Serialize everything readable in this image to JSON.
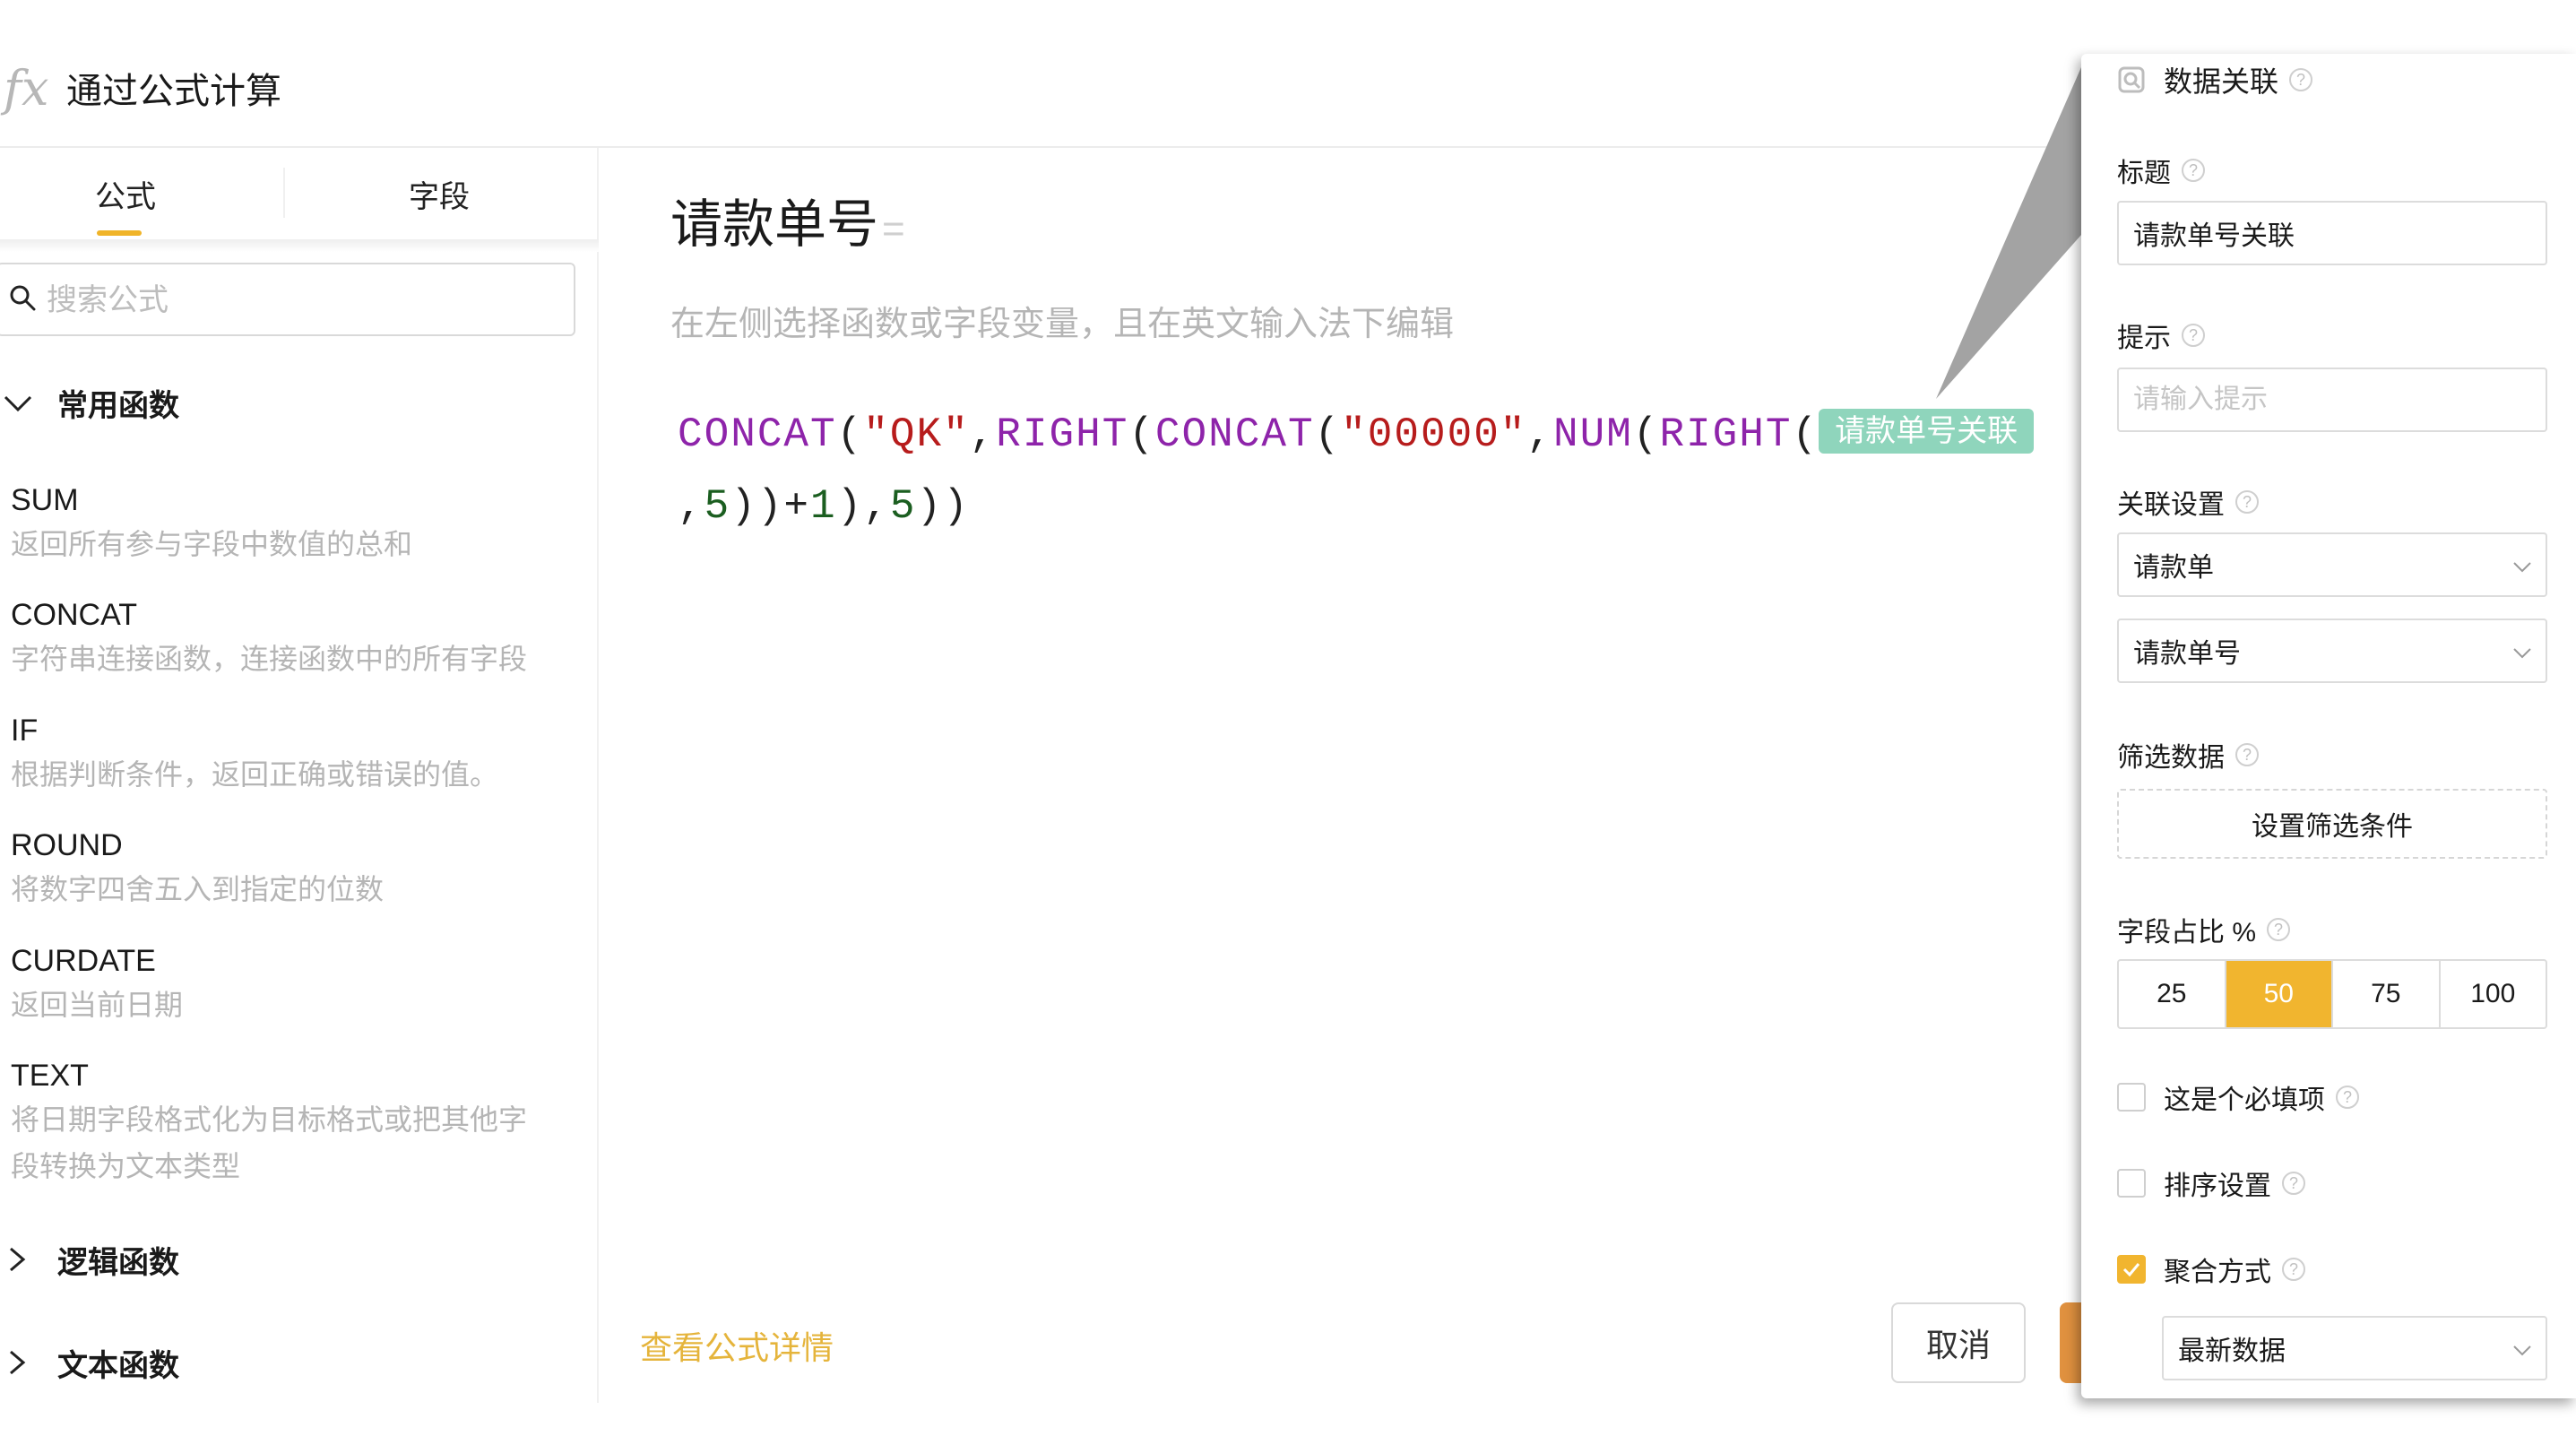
{
  "header": {
    "fx_icon": "fx",
    "title": "通过公式计算"
  },
  "left_panel": {
    "tabs": [
      {
        "label": "公式"
      },
      {
        "label": "字段"
      }
    ],
    "search": {
      "placeholder": "搜索公式",
      "value": ""
    },
    "categories": [
      {
        "label": "常用函数",
        "expanded": true,
        "functions": [
          {
            "name": "SUM",
            "desc": "返回所有参与字段中数值的总和"
          },
          {
            "name": "CONCAT",
            "desc": "字符串连接函数，连接函数中的所有字段"
          },
          {
            "name": "IF",
            "desc": "根据判断条件，返回正确或错误的值。"
          },
          {
            "name": "ROUND",
            "desc": "将数字四舍五入到指定的位数"
          },
          {
            "name": "CURDATE",
            "desc": "返回当前日期"
          },
          {
            "name": "TEXT",
            "desc": "将日期字段格式化为目标格式或把其他字",
            "desc2": "段转换为文本类型"
          }
        ]
      },
      {
        "label": "逻辑函数",
        "expanded": false
      },
      {
        "label": "文本函数",
        "expanded": false
      }
    ]
  },
  "editor": {
    "field_title": "请款单号",
    "equals": "=",
    "hint": "在左侧选择函数或字段变量，且在英文输入法下编辑",
    "formula": {
      "line1": [
        {
          "t": "k",
          "v": "CONCAT"
        },
        {
          "t": "p",
          "v": "("
        },
        {
          "t": "s",
          "v": "\"QK\""
        },
        {
          "t": "p",
          "v": ","
        },
        {
          "t": "k",
          "v": "RIGHT"
        },
        {
          "t": "p",
          "v": "("
        },
        {
          "t": "k",
          "v": "CONCAT"
        },
        {
          "t": "p",
          "v": "("
        },
        {
          "t": "s",
          "v": "\"00000\""
        },
        {
          "t": "p",
          "v": ","
        },
        {
          "t": "k",
          "v": "NUM"
        },
        {
          "t": "p",
          "v": "("
        },
        {
          "t": "k",
          "v": "RIGHT"
        },
        {
          "t": "p",
          "v": "("
        }
      ],
      "field_chip": "请款单号关联",
      "line2": [
        {
          "t": "p",
          "v": ","
        },
        {
          "t": "n",
          "v": "5"
        },
        {
          "t": "p",
          "v": "))+"
        },
        {
          "t": "n",
          "v": "1"
        },
        {
          "t": "p",
          "v": "),"
        },
        {
          "t": "n",
          "v": "5"
        },
        {
          "t": "p",
          "v": "))"
        }
      ]
    },
    "details_link": "查看公式详情",
    "cancel_label": "取消"
  },
  "side_panel": {
    "header_title": "数据关联",
    "title_label": "标题",
    "title_value": "请款单号关联",
    "hint_label": "提示",
    "hint_placeholder": "请输入提示",
    "link_label": "关联设置",
    "link_form": "请款单",
    "link_field": "请款单号",
    "filter_label": "筛选数据",
    "filter_button": "设置筛选条件",
    "ratio_label": "字段占比 %",
    "ratio_options": [
      "25",
      "50",
      "75",
      "100"
    ],
    "ratio_selected": "50",
    "required_label": "这是个必填项",
    "required_checked": false,
    "sort_label": "排序设置",
    "sort_checked": false,
    "aggregate_label": "聚合方式",
    "aggregate_checked": true,
    "aggregate_value": "最新数据"
  },
  "colors": {
    "accent": "#f1b52f",
    "chip": "#8fd5bc",
    "function_keyword": "#8e24aa",
    "string_literal": "#b71c1c",
    "number_literal": "#1b5e20",
    "link": "#e5b43b",
    "ok_button": "#e0913f"
  },
  "icons": [
    "fx-icon",
    "search-icon",
    "chevron-down-icon",
    "chevron-right-icon",
    "help-icon",
    "data-link-icon",
    "check-icon"
  ]
}
